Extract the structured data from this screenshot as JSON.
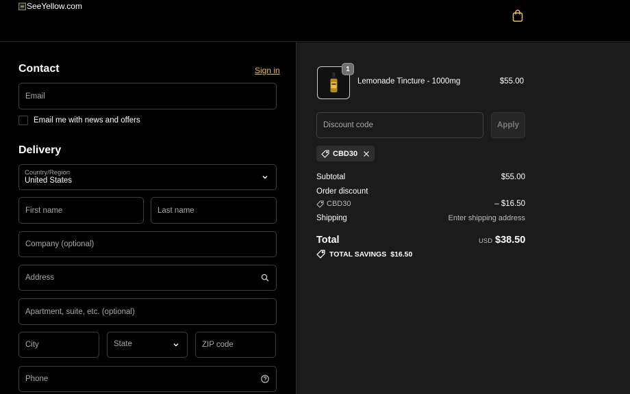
{
  "header": {
    "logo_alt": "SeeYellow.com",
    "cart_icon": "shopping-bag-icon"
  },
  "contact": {
    "title": "Contact",
    "signin_label": "Sign in",
    "email_placeholder": "Email",
    "newsletter_label": "Email me with news and offers"
  },
  "delivery": {
    "title": "Delivery",
    "country_label": "Country/Region",
    "country_value": "United States",
    "first_name_placeholder": "First name",
    "last_name_placeholder": "Last name",
    "company_placeholder": "Company (optional)",
    "address_placeholder": "Address",
    "apartment_placeholder": "Apartment, suite, etc. (optional)",
    "city_placeholder": "City",
    "state_placeholder": "State",
    "zip_placeholder": "ZIP code",
    "phone_placeholder": "Phone"
  },
  "summary": {
    "product": {
      "name": "Lemonade Tincture - 1000mg",
      "price": "$55.00",
      "quantity": "1"
    },
    "discount_placeholder": "Discount code",
    "apply_label": "Apply",
    "applied_code": "CBD30",
    "subtotal_label": "Subtotal",
    "subtotal_value": "$55.00",
    "order_discount_label": "Order discount",
    "discount_code": "CBD30",
    "discount_value": "– $16.50",
    "shipping_label": "Shipping",
    "shipping_value": "Enter shipping address",
    "total_label": "Total",
    "total_currency": "USD",
    "total_value": "$38.50",
    "savings_label": "TOTAL SAVINGS",
    "savings_value": "$16.50"
  },
  "colors": {
    "accent": "#e8c24a",
    "background": "#000000",
    "summary_background": "#1b1b1b"
  }
}
